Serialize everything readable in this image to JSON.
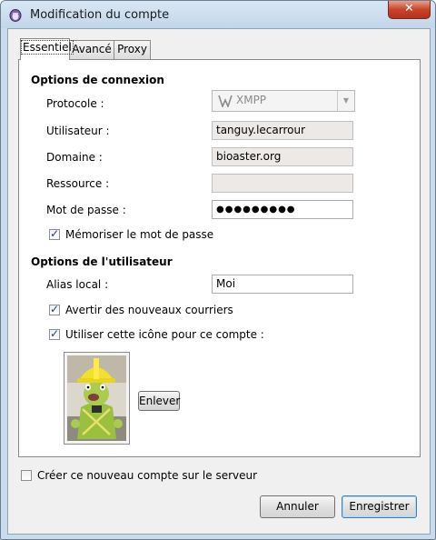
{
  "window": {
    "title": "Modification du compte",
    "close_glyph": "✕"
  },
  "tabs": [
    {
      "label": "Essentiel",
      "active": true
    },
    {
      "label": "Avancé",
      "active": false
    },
    {
      "label": "Proxy",
      "active": false
    }
  ],
  "connection": {
    "heading": "Options de connexion",
    "protocol": {
      "label": "Protocole :",
      "value": "XMPP",
      "icon": "xmpp-icon"
    },
    "username": {
      "label": "Utilisateur :",
      "value": "tanguy.lecarrour"
    },
    "domain": {
      "label": "Domaine :",
      "value": "bioaster.org"
    },
    "resource": {
      "label": "Ressource :",
      "value": ""
    },
    "password": {
      "label": "Mot de passe :",
      "value": "●●●●●●●●●"
    },
    "remember": {
      "label": "Mémoriser le mot de passe",
      "checked": true
    }
  },
  "user": {
    "heading": "Options de l'utilisateur",
    "alias": {
      "label": "Alias local :",
      "value": "Moi"
    },
    "notify_mail": {
      "label": "Avertir des nouveaux courriers",
      "checked": true
    },
    "use_icon": {
      "label": "Utiliser cette icône pour ce compte :",
      "checked": true
    },
    "remove_label": "Enlever"
  },
  "create_on_server": {
    "label": "Créer ce nouveau compte sur le serveur",
    "checked": false
  },
  "buttons": {
    "cancel": "Annuler",
    "save": "Enregistrer"
  },
  "colors": {
    "titlebar": "#c9dcee",
    "close": "#c7432a",
    "accent": "#3c7fb1"
  }
}
